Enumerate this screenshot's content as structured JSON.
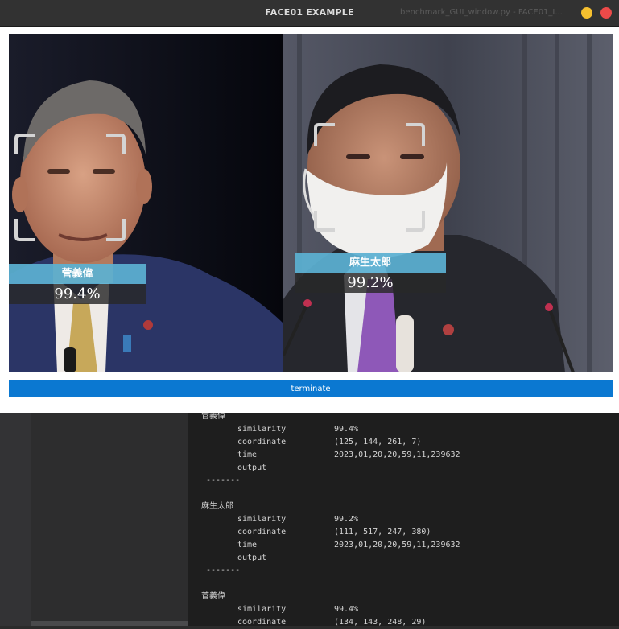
{
  "window": {
    "title": "FACE01 EXAMPLE",
    "ghost_title": "benchmark_GUI_window.py - FACE01_I..."
  },
  "faces": [
    {
      "name": "菅義偉",
      "score": "99.4%"
    },
    {
      "name": "麻生太郎",
      "score": "99.2%"
    }
  ],
  "terminate_label": "terminate",
  "log": {
    "separator": "-------",
    "entries": [
      {
        "name": "菅義偉",
        "fields": [
          {
            "key": "similarity",
            "value": "99.4%"
          },
          {
            "key": "coordinate",
            "value": "(125, 144, 261, 7)"
          },
          {
            "key": "time",
            "value": "2023,01,20,20,59,11,239632"
          },
          {
            "key": "output",
            "value": ""
          }
        ]
      },
      {
        "name": "麻生太郎",
        "fields": [
          {
            "key": "similarity",
            "value": "99.2%"
          },
          {
            "key": "coordinate",
            "value": "(111, 517, 247, 380)"
          },
          {
            "key": "time",
            "value": "2023,01,20,20,59,11,239632"
          },
          {
            "key": "output",
            "value": ""
          }
        ]
      },
      {
        "name": "菅義偉",
        "fields": [
          {
            "key": "similarity",
            "value": "99.4%"
          },
          {
            "key": "coordinate",
            "value": "(134, 143, 248, 29)"
          }
        ]
      }
    ]
  },
  "colors": {
    "accent": "#0b78d1",
    "label_bg": "#5bb0d2",
    "minimize": "#f6c02f",
    "close": "#ed4a49"
  }
}
